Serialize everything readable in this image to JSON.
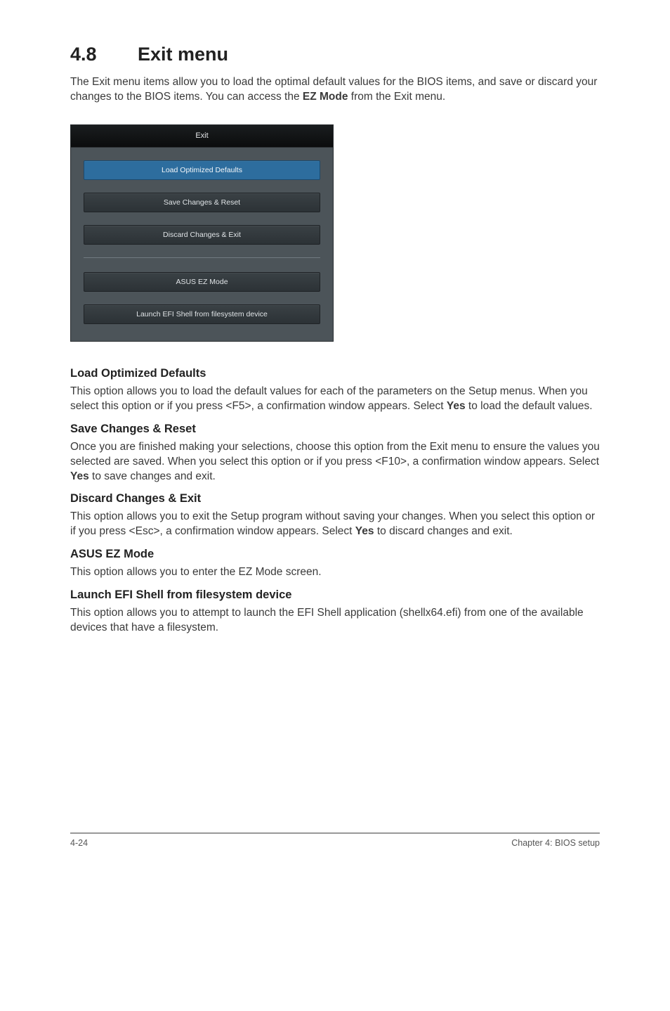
{
  "heading": {
    "num": "4.8",
    "title": "Exit menu"
  },
  "intro": {
    "pre": "The Exit menu items allow you to load the optimal default values for the BIOS items, and save or discard your changes to the BIOS items. You can access the ",
    "bold": "EZ Mode",
    "post": " from the Exit menu."
  },
  "bios": {
    "header": "Exit",
    "btn_load": "Load Optimized Defaults",
    "btn_save": "Save Changes & Reset",
    "btn_discard": "Discard Changes & Exit",
    "btn_ez": "ASUS EZ Mode",
    "btn_shell": "Launch EFI Shell from filesystem device"
  },
  "sections": {
    "load": {
      "title": "Load Optimized Defaults",
      "p_pre": "This option allows you to load the default values for each of the parameters on the Setup menus. When you select this option or if you press <F5>, a confirmation window appears. Select ",
      "p_bold": "Yes",
      "p_post": " to load the default values."
    },
    "save": {
      "title": "Save Changes & Reset",
      "p_pre": "Once you are finished making your selections, choose this option from the Exit menu to ensure the values you selected are saved. When you select this option or if you press <F10>, a confirmation window appears. Select ",
      "p_bold": "Yes",
      "p_post": " to save changes and exit."
    },
    "discard": {
      "title": "Discard Changes & Exit",
      "p_pre": "This option allows you to exit the Setup program without saving your changes. When you select this option or if you press <Esc>, a confirmation window appears. Select ",
      "p_bold": "Yes",
      "p_post": " to discard changes and exit."
    },
    "ez": {
      "title": "ASUS EZ Mode",
      "p": "This option allows you to enter the EZ Mode screen."
    },
    "shell": {
      "title": "Launch EFI Shell from filesystem device",
      "p": "This option allows you to attempt to launch the EFI Shell application (shellx64.efi) from one of the available devices that have a filesystem."
    }
  },
  "footer": {
    "left": "4-24",
    "right": "Chapter 4: BIOS setup"
  }
}
